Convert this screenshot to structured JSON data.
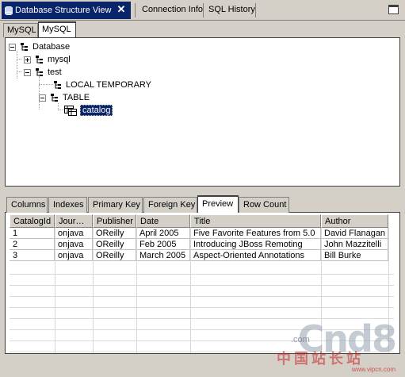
{
  "view_tabs": {
    "active_label": "Database Structure View",
    "tab2_label": "Connection Info",
    "tab3_label": "SQL History"
  },
  "connection_tabs": [
    "MySQL",
    "MySQL"
  ],
  "tree": {
    "root": "Database",
    "mysql": "mysql",
    "test": "test",
    "local_temp": "LOCAL TEMPORARY",
    "table_folder": "TABLE",
    "catalog": "catalog"
  },
  "detail_tabs": [
    "Columns",
    "Indexes",
    "Primary Key",
    "Foreign Key",
    "Preview",
    "Row Count"
  ],
  "active_detail_tab": "Preview",
  "table": {
    "columns": [
      "CatalogId",
      "Jour…",
      "Publisher",
      "Date",
      "Title",
      "Author"
    ],
    "rows": [
      [
        "1",
        "onjava",
        "OReilly",
        "April 2005",
        "Five Favorite Features from 5.0",
        "David Flanagan"
      ],
      [
        "2",
        "onjava",
        "OReilly",
        "Feb 2005",
        "Introducing JBoss Remoting",
        "John Mazzitelli"
      ],
      [
        "3",
        "onjava",
        "OReilly",
        "March 2005",
        "Aspect-Oriented Annotations",
        "Bill Burke"
      ]
    ]
  },
  "watermark": {
    "logo": "Cnd8",
    "com": ".com",
    "cn_text": "中国站长站",
    "url": "www.vipcn.com"
  },
  "colors": {
    "active_tab_bg": "#0a246a",
    "panel_bg": "#d4d0c8",
    "selection": "#0a246a"
  }
}
